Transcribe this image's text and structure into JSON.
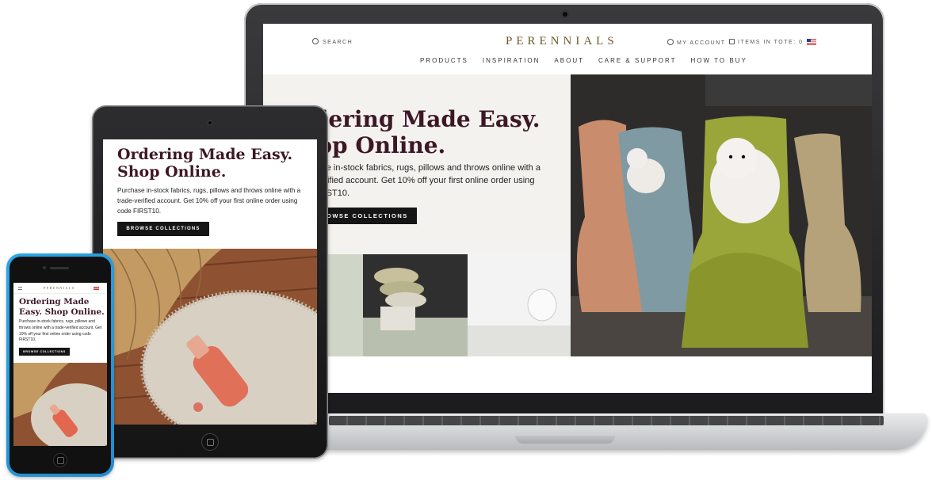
{
  "brand": "PERENNIALS",
  "laptop": {
    "header": {
      "search_label": "SEARCH",
      "brand_logo": "PERENNIALS",
      "account_label": "MY ACCOUNT",
      "tote_label": "ITEMS IN TOTE: 0",
      "flag_icon": "us-flag-icon"
    },
    "nav": [
      "PRODUCTS",
      "INSPIRATION",
      "ABOUT",
      "CARE & SUPPORT",
      "HOW TO BUY"
    ],
    "hero": {
      "title": "Ordering Made Easy. Shop Online.",
      "title_visible": "rdering Made Easy.\nhop Online.",
      "body_visible": "hase in-stock fabrics, rugs, pillows and throws online with a\n-verified account. Get 10% off your first online order using\nFIRST10.",
      "button_visible": "OWSE COLLECTIONS"
    }
  },
  "tablet": {
    "title": "Ordering Made Easy. Shop Online.",
    "body": "Purchase in-stock fabrics, rugs, pillows and throws online with a trade-verified account. Get 10% off your first online order using code FIRST10.",
    "button": "BROWSE COLLECTIONS"
  },
  "phone": {
    "logo": "PERENNIALS",
    "title": "Ordering Made Easy. Shop Online.",
    "body": "Purchase in-stock fabrics, rugs, pillows and throws online with a trade-verified account. Get 10% off your first online order using code FIRST10.",
    "button": "BROWSE COLLECTIONS"
  },
  "colors": {
    "title": "#3d1726",
    "brand_gold": "#6b5a2a",
    "button_bg": "#151515",
    "phone_body": "#2ba6e4"
  }
}
